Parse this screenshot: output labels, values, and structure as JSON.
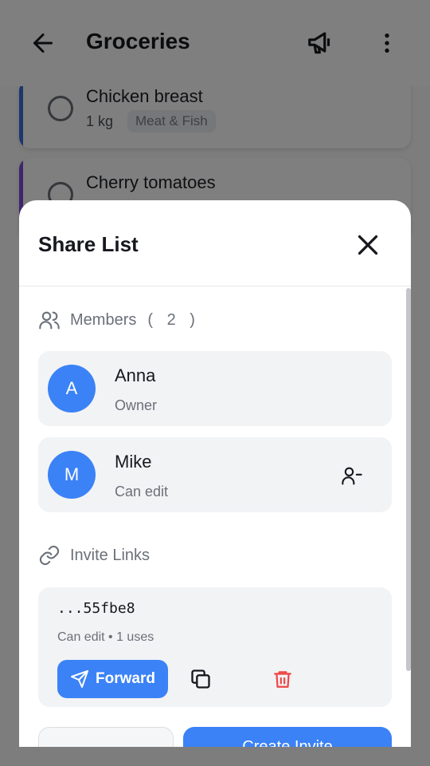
{
  "appbar": {
    "title": "Groceries",
    "back_icon": "arrow-left-icon",
    "action_icon": "megaphone-icon",
    "menu_icon": "more-vertical-icon"
  },
  "list": {
    "items": [
      {
        "name": "Chicken breast",
        "quantity": "1 kg",
        "category": "Meat & Fish",
        "accent": "#3b6fd8"
      },
      {
        "name": "Cherry tomatoes",
        "quantity": "",
        "category": "",
        "accent": "#7c4ddb"
      }
    ]
  },
  "sheet": {
    "title": "Share List",
    "members_label": "Members",
    "members_count": "( 2 )",
    "members": [
      {
        "initial": "A",
        "name": "Anna",
        "role": "Owner"
      },
      {
        "initial": "M",
        "name": "Mike",
        "role": "Can edit"
      }
    ],
    "invite_label": "Invite Links",
    "invite": {
      "code": "...55fbe8",
      "meta": "Can edit • 1 uses",
      "forward_label": "Forward"
    },
    "create_invite_label": "Create Invite"
  },
  "colors": {
    "primary": "#3b82f6",
    "danger": "#ef4444"
  }
}
